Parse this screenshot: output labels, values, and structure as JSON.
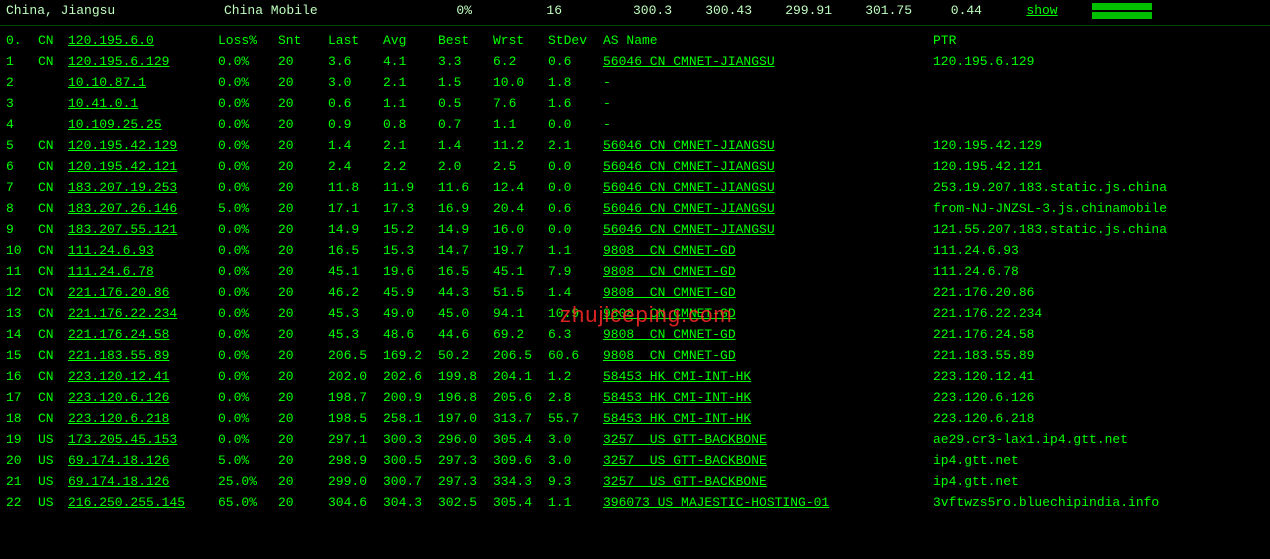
{
  "top": {
    "location": "China, Jiangsu",
    "isp": "China Mobile",
    "pct": "0%",
    "n1": "16",
    "n2": "300.3",
    "n3": "300.43",
    "n4": "299.91",
    "n5": "301.75",
    "n6": "0.44",
    "show": "show"
  },
  "headers": {
    "hop": "0.",
    "cc": "CN",
    "ip": "120.195.6.0",
    "loss": "Loss%",
    "snt": "Snt",
    "last": "Last",
    "avg": "Avg",
    "best": "Best",
    "wrst": "Wrst",
    "stdev": "StDev",
    "asn": "AS Name",
    "ptr": "PTR"
  },
  "rows": [
    {
      "hop": "1",
      "cc": "CN",
      "ip": "120.195.6.129",
      "loss": "0.0%",
      "snt": "20",
      "last": "3.6",
      "avg": "4.1",
      "best": "3.3",
      "wrst": "6.2",
      "stdev": "0.6",
      "asn": "56046 CN CMNET-JIANGSU",
      "ptr": "120.195.6.129"
    },
    {
      "hop": "2",
      "cc": "",
      "ip": "10.10.87.1",
      "loss": "0.0%",
      "snt": "20",
      "last": "3.0",
      "avg": "2.1",
      "best": "1.5",
      "wrst": "10.0",
      "stdev": "1.8",
      "asn": "-",
      "ptr": ""
    },
    {
      "hop": "3",
      "cc": "",
      "ip": "10.41.0.1",
      "loss": "0.0%",
      "snt": "20",
      "last": "0.6",
      "avg": "1.1",
      "best": "0.5",
      "wrst": "7.6",
      "stdev": "1.6",
      "asn": "-",
      "ptr": ""
    },
    {
      "hop": "4",
      "cc": "",
      "ip": "10.109.25.25",
      "loss": "0.0%",
      "snt": "20",
      "last": "0.9",
      "avg": "0.8",
      "best": "0.7",
      "wrst": "1.1",
      "stdev": "0.0",
      "asn": "-",
      "ptr": ""
    },
    {
      "hop": "5",
      "cc": "CN",
      "ip": "120.195.42.129",
      "loss": "0.0%",
      "snt": "20",
      "last": "1.4",
      "avg": "2.1",
      "best": "1.4",
      "wrst": "11.2",
      "stdev": "2.1",
      "asn": "56046 CN CMNET-JIANGSU",
      "ptr": "120.195.42.129"
    },
    {
      "hop": "6",
      "cc": "CN",
      "ip": "120.195.42.121",
      "loss": "0.0%",
      "snt": "20",
      "last": "2.4",
      "avg": "2.2",
      "best": "2.0",
      "wrst": "2.5",
      "stdev": "0.0",
      "asn": "56046 CN CMNET-JIANGSU",
      "ptr": "120.195.42.121"
    },
    {
      "hop": "7",
      "cc": "CN",
      "ip": "183.207.19.253",
      "loss": "0.0%",
      "snt": "20",
      "last": "11.8",
      "avg": "11.9",
      "best": "11.6",
      "wrst": "12.4",
      "stdev": "0.0",
      "asn": "56046 CN CMNET-JIANGSU",
      "ptr": "253.19.207.183.static.js.china"
    },
    {
      "hop": "8",
      "cc": "CN",
      "ip": "183.207.26.146",
      "loss": "5.0%",
      "snt": "20",
      "last": "17.1",
      "avg": "17.3",
      "best": "16.9",
      "wrst": "20.4",
      "stdev": "0.6",
      "asn": "56046 CN CMNET-JIANGSU",
      "ptr": "from-NJ-JNZSL-3.js.chinamobile"
    },
    {
      "hop": "9",
      "cc": "CN",
      "ip": "183.207.55.121",
      "loss": "0.0%",
      "snt": "20",
      "last": "14.9",
      "avg": "15.2",
      "best": "14.9",
      "wrst": "16.0",
      "stdev": "0.0",
      "asn": "56046 CN CMNET-JIANGSU",
      "ptr": "121.55.207.183.static.js.china"
    },
    {
      "hop": "10",
      "cc": "CN",
      "ip": "111.24.6.93",
      "loss": "0.0%",
      "snt": "20",
      "last": "16.5",
      "avg": "15.3",
      "best": "14.7",
      "wrst": "19.7",
      "stdev": "1.1",
      "asn": "9808  CN CMNET-GD",
      "ptr": "111.24.6.93"
    },
    {
      "hop": "11",
      "cc": "CN",
      "ip": "111.24.6.78",
      "loss": "0.0%",
      "snt": "20",
      "last": "45.1",
      "avg": "19.6",
      "best": "16.5",
      "wrst": "45.1",
      "stdev": "7.9",
      "asn": "9808  CN CMNET-GD",
      "ptr": "111.24.6.78"
    },
    {
      "hop": "12",
      "cc": "CN",
      "ip": "221.176.20.86",
      "loss": "0.0%",
      "snt": "20",
      "last": "46.2",
      "avg": "45.9",
      "best": "44.3",
      "wrst": "51.5",
      "stdev": "1.4",
      "asn": "9808  CN CMNET-GD",
      "ptr": "221.176.20.86"
    },
    {
      "hop": "13",
      "cc": "CN",
      "ip": "221.176.22.234",
      "loss": "0.0%",
      "snt": "20",
      "last": "45.3",
      "avg": "49.0",
      "best": "45.0",
      "wrst": "94.1",
      "stdev": "10.9",
      "asn": "9808  CN CMNET-GD",
      "ptr": "221.176.22.234"
    },
    {
      "hop": "14",
      "cc": "CN",
      "ip": "221.176.24.58",
      "loss": "0.0%",
      "snt": "20",
      "last": "45.3",
      "avg": "48.6",
      "best": "44.6",
      "wrst": "69.2",
      "stdev": "6.3",
      "asn": "9808  CN CMNET-GD",
      "ptr": "221.176.24.58"
    },
    {
      "hop": "15",
      "cc": "CN",
      "ip": "221.183.55.89",
      "loss": "0.0%",
      "snt": "20",
      "last": "206.5",
      "avg": "169.2",
      "best": "50.2",
      "wrst": "206.5",
      "stdev": "60.6",
      "asn": "9808  CN CMNET-GD",
      "ptr": "221.183.55.89"
    },
    {
      "hop": "16",
      "cc": "CN",
      "ip": "223.120.12.41",
      "loss": "0.0%",
      "snt": "20",
      "last": "202.0",
      "avg": "202.6",
      "best": "199.8",
      "wrst": "204.1",
      "stdev": "1.2",
      "asn": "58453 HK CMI-INT-HK",
      "ptr": "223.120.12.41"
    },
    {
      "hop": "17",
      "cc": "CN",
      "ip": "223.120.6.126",
      "loss": "0.0%",
      "snt": "20",
      "last": "198.7",
      "avg": "200.9",
      "best": "196.8",
      "wrst": "205.6",
      "stdev": "2.8",
      "asn": "58453 HK CMI-INT-HK",
      "ptr": "223.120.6.126"
    },
    {
      "hop": "18",
      "cc": "CN",
      "ip": "223.120.6.218",
      "loss": "0.0%",
      "snt": "20",
      "last": "198.5",
      "avg": "258.1",
      "best": "197.0",
      "wrst": "313.7",
      "stdev": "55.7",
      "asn": "58453 HK CMI-INT-HK",
      "ptr": "223.120.6.218"
    },
    {
      "hop": "19",
      "cc": "US",
      "ip": "173.205.45.153",
      "loss": "0.0%",
      "snt": "20",
      "last": "297.1",
      "avg": "300.3",
      "best": "296.0",
      "wrst": "305.4",
      "stdev": "3.0",
      "asn": "3257  US GTT-BACKBONE",
      "ptr": "ae29.cr3-lax1.ip4.gtt.net"
    },
    {
      "hop": "20",
      "cc": "US",
      "ip": "69.174.18.126",
      "loss": "5.0%",
      "snt": "20",
      "last": "298.9",
      "avg": "300.5",
      "best": "297.3",
      "wrst": "309.6",
      "stdev": "3.0",
      "asn": "3257  US GTT-BACKBONE",
      "ptr": "ip4.gtt.net"
    },
    {
      "hop": "21",
      "cc": "US",
      "ip": "69.174.18.126",
      "loss": "25.0%",
      "snt": "20",
      "last": "299.0",
      "avg": "300.7",
      "best": "297.3",
      "wrst": "334.3",
      "stdev": "9.3",
      "asn": "3257  US GTT-BACKBONE",
      "ptr": "ip4.gtt.net"
    },
    {
      "hop": "22",
      "cc": "US",
      "ip": "216.250.255.145",
      "loss": "65.0%",
      "snt": "20",
      "last": "304.6",
      "avg": "304.3",
      "best": "302.5",
      "wrst": "305.4",
      "stdev": "1.1",
      "asn": "396073 US MAJESTIC-HOSTING-01",
      "ptr": "3vftwzs5ro.bluechipindia.info"
    }
  ],
  "watermark": "zhujiceping.com"
}
